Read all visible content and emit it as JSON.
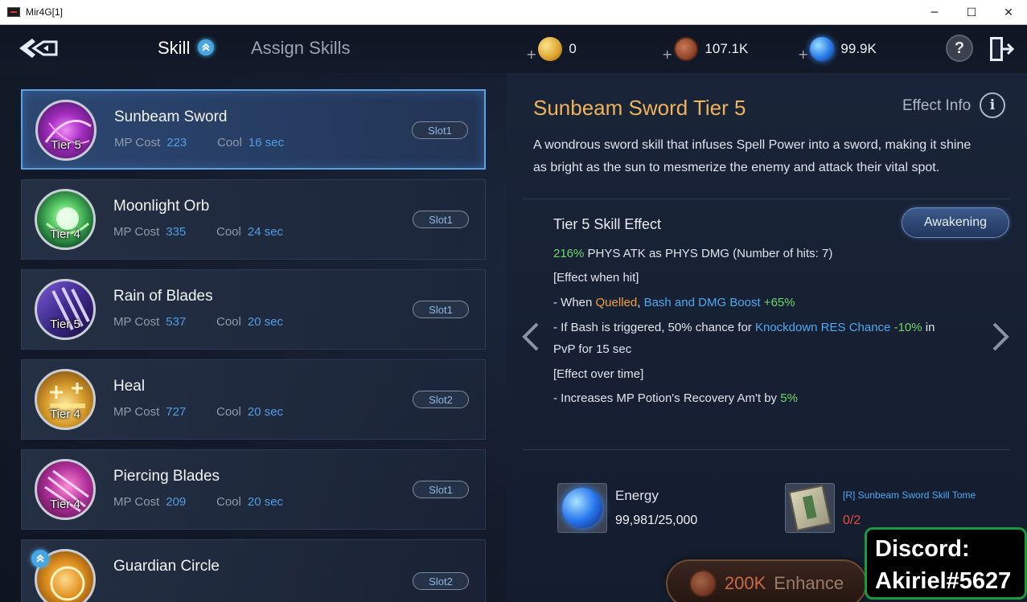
{
  "window": {
    "title": "Mir4G[1]",
    "controls": [
      "─",
      "☐",
      "✕"
    ]
  },
  "topbar": {
    "tab_skill": "Skill",
    "tab_assign": "Assign Skills",
    "currencies": [
      {
        "icon": "gold-coin-icon",
        "value": "0"
      },
      {
        "icon": "copper-coin-icon",
        "value": "107.1K"
      },
      {
        "icon": "energy-orb-icon",
        "value": "99.9K"
      }
    ],
    "help_label": "?"
  },
  "skills": [
    {
      "name": "Sunbeam Sword",
      "tier": "Tier 5",
      "mp_label": "MP Cost",
      "mp": "223",
      "cool_label": "Cool",
      "cool": "16 sec",
      "slot": "Slot1",
      "selected": true,
      "icon": "sunbeam-sword-icon"
    },
    {
      "name": "Moonlight Orb",
      "tier": "Tier 4",
      "mp_label": "MP Cost",
      "mp": "335",
      "cool_label": "Cool",
      "cool": "24 sec",
      "slot": "Slot1",
      "selected": false,
      "icon": "moonlight-orb-icon"
    },
    {
      "name": "Rain of Blades",
      "tier": "Tier 5",
      "mp_label": "MP Cost",
      "mp": "537",
      "cool_label": "Cool",
      "cool": "20 sec",
      "slot": "Slot1",
      "selected": false,
      "icon": "rain-of-blades-icon"
    },
    {
      "name": "Heal",
      "tier": "Tier 4",
      "mp_label": "MP Cost",
      "mp": "727",
      "cool_label": "Cool",
      "cool": "20 sec",
      "slot": "Slot2",
      "selected": false,
      "icon": "heal-icon"
    },
    {
      "name": "Piercing Blades",
      "tier": "Tier 4",
      "mp_label": "MP Cost",
      "mp": "209",
      "cool_label": "Cool",
      "cool": "20 sec",
      "slot": "Slot1",
      "selected": false,
      "icon": "piercing-blades-icon"
    },
    {
      "name": "Guardian Circle",
      "tier": "",
      "mp_label": "",
      "mp": "",
      "cool_label": "",
      "cool": "",
      "slot": "Slot2",
      "selected": false,
      "icon": "guardian-circle-icon"
    }
  ],
  "detail": {
    "title": "Sunbeam Sword Tier 5",
    "effect_info": "Effect Info",
    "description_1": "A wondrous sword skill that infuses Spell Power into a sword, making it shine",
    "description_2": "as bright as the sun to mesmerize the enemy and attack their vital spot.",
    "effect_heading": "Tier 5 Skill Effect",
    "awakening": "Awakening",
    "effects": {
      "l1_pct": "216%",
      "l1_text": " PHYS ATK as PHYS DMG (Number of hits: 7)",
      "l2": "[Effect when hit]",
      "l3_pre": " - When ",
      "l3_quelled": "Quelled",
      "l3_comma": ", ",
      "l3_bash": "Bash and DMG Boost",
      "l3_val": " +65%",
      "l4_pre": " - If Bash is triggered, 50% chance for ",
      "l4_kd": "Knockdown RES Chance",
      "l4_val": " -10%",
      "l4_post": " in",
      "l5": "PvP for 15 sec",
      "l6": "[Effect over time]",
      "l7_pre": " - Increases MP Potion's Recovery Am't by ",
      "l7_val": "5%"
    },
    "energy_label": "Energy",
    "energy_value": "99,981/25,000",
    "tome_label": "[R] Sunbeam Sword Skill Tome",
    "tome_value": "0/2",
    "enhance_cost": "200K",
    "enhance_label": "Enhance"
  },
  "overlay": {
    "line1": "Discord:",
    "line2": "Akiriel#5627"
  },
  "colors": {
    "accent_gold": "#f0b458",
    "accent_blue": "#4fa8f0",
    "value_green": "#6fd66a",
    "warning_red": "#e84a40",
    "discord_border": "#1a9a3a"
  }
}
